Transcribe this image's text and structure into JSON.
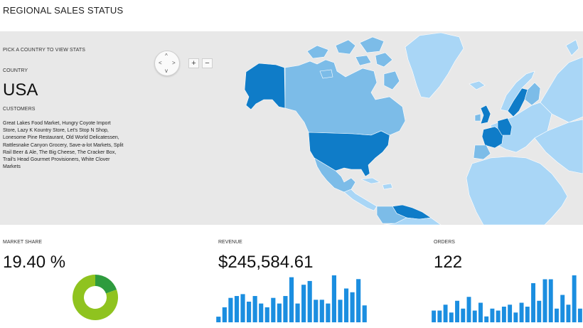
{
  "title": "REGIONAL SALES STATUS",
  "map": {
    "prompt": "PICK A COUNTRY TO VIEW STATS",
    "country_label": "COUNTRY",
    "country_value": "USA",
    "customers_label": "CUSTOMERS",
    "customers_value": "Great Lakes Food Market, Hungry Coyote Import Store, Lazy K Kountry Store, Let's Stop N Shop, Lonesome Pine Restaurant, Old World Delicatessen, Rattlesnake Canyon Grocery, Save-a-lot Markets, Split Rail Beer & Ale, The Big Cheese, The Cracker Box, Trail's Head Gourmet Provisioners, White Clover Markets",
    "controls": {
      "zoom_in": "+",
      "zoom_out": "−",
      "pan_up": "^",
      "pan_down": "v",
      "pan_left": "<",
      "pan_right": ">"
    },
    "colors": {
      "ocean": "#e8e8e8",
      "selected": "#0f7cc8",
      "medium": "#7cbce8",
      "light": "#a9d6f6"
    }
  },
  "kpis": {
    "market_share": {
      "label": "MARKET SHARE",
      "value": "19.40 %"
    },
    "revenue": {
      "label": "REVENUE",
      "value": "$245,584.61"
    },
    "orders": {
      "label": "ORDERS",
      "value": "122"
    }
  },
  "chart_data": [
    {
      "type": "pie",
      "variant": "donut",
      "values": [
        19.4,
        80.6
      ],
      "colors": [
        "#2e9b3e",
        "#8fc31f"
      ]
    },
    {
      "type": "bar",
      "values": [
        3,
        8,
        13,
        14,
        15,
        11,
        14,
        10,
        8,
        13,
        10,
        14,
        24,
        10,
        20,
        22,
        12,
        12,
        10,
        25,
        12,
        18,
        16,
        23,
        9
      ],
      "color": "#1b8ee0"
    },
    {
      "type": "bar",
      "values": [
        6,
        6,
        9,
        5,
        11,
        7,
        13,
        6,
        10,
        3,
        7,
        6,
        8,
        9,
        5,
        10,
        8,
        20,
        11,
        22,
        22,
        7,
        14,
        9,
        24,
        7
      ],
      "color": "#1b8ee0"
    }
  ]
}
